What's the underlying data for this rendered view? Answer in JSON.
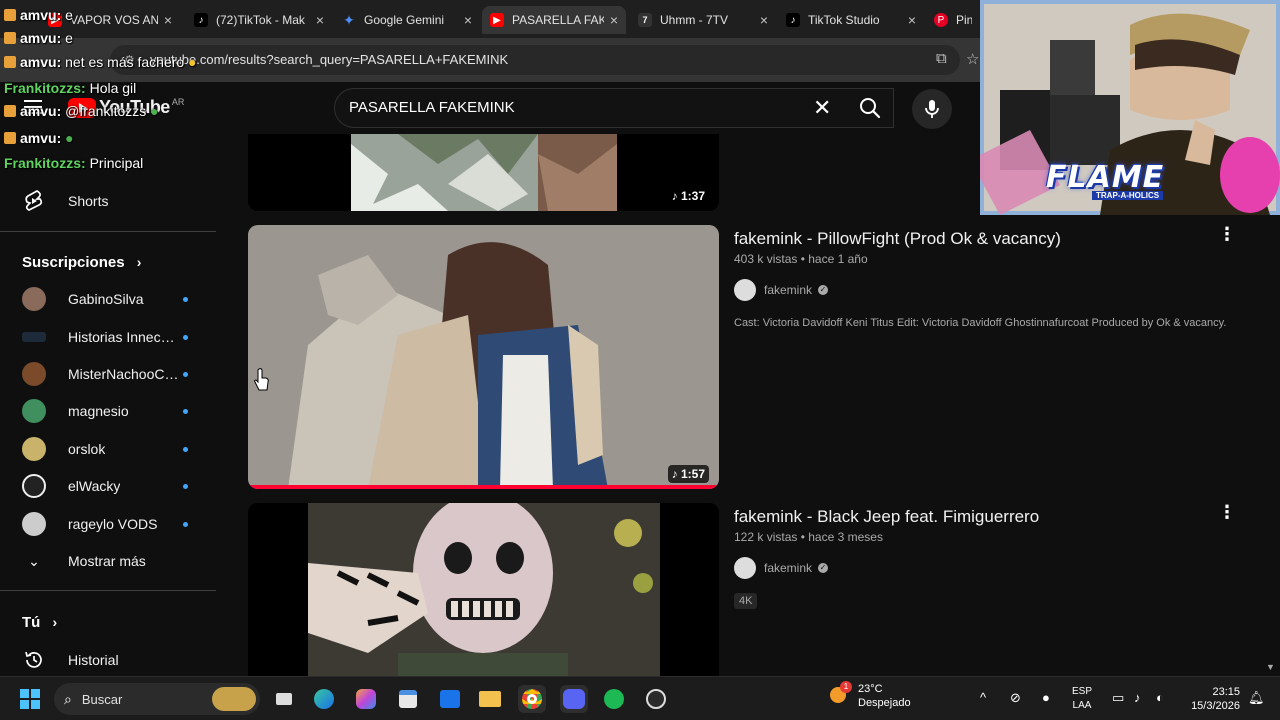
{
  "browser": {
    "tabs": [
      {
        "label": "VAPOR VOS AN",
        "favicon": "youtube-icon",
        "color": "#ff0000",
        "active": false
      },
      {
        "label": "(72)TikTok - Mak",
        "favicon": "tiktok-icon",
        "color": "#000000",
        "active": false
      },
      {
        "label": "Google Gemini",
        "favicon": "gemini-icon",
        "color": "#4f8ef7",
        "active": false
      },
      {
        "label": "PASARELLA FAK",
        "favicon": "youtube-icon",
        "color": "#ff0000",
        "active": true
      },
      {
        "label": "Uhmm - 7TV",
        "favicon": "7tv-icon",
        "color": "#333333",
        "active": false
      },
      {
        "label": "TikTok Studio",
        "favicon": "tiktok-icon",
        "color": "#000000",
        "active": false
      },
      {
        "label": "Pinte",
        "favicon": "pinterest-icon",
        "color": "#e60023",
        "active": false
      }
    ],
    "url": "youtube.com/results?search_query=PASARELLA+FAKEMINK"
  },
  "youtube": {
    "logo_word": "YouTube",
    "country": "AR",
    "search_query": "PASARELLA FAKEMINK"
  },
  "sidebar": {
    "shorts": "Shorts",
    "subscriptions_header": "Suscripciones",
    "subscriptions": [
      {
        "label": "GabinoSilva",
        "color": "#8a6a5a"
      },
      {
        "label": "Historias Innece...",
        "color": "#1d2a3a"
      },
      {
        "label": "MisterNachooCli...",
        "color": "#7a4a2a"
      },
      {
        "label": "magnesio",
        "color": "#3f8f5f"
      },
      {
        "label": "orslok",
        "color": "#c9b36a"
      },
      {
        "label": "elWacky",
        "color": "#222222"
      },
      {
        "label": "rageylo VODS",
        "color": "#cccccc"
      }
    ],
    "show_more": "Mostrar más",
    "you_header": "Tú",
    "history": "Historial"
  },
  "results": [
    {
      "duration": "1:37"
    },
    {
      "title": "fakemink - PillowFight (Prod Ok & vacancy)",
      "meta": "403 k vistas • hace 1 año",
      "channel": "fakemink",
      "description": "Cast: Victoria Davidoff Keni Titus Edit: Victoria Davidoff Ghostinnafurcoat Produced by Ok & vacancy.",
      "duration": "1:57",
      "watched_fraction": 1.0
    },
    {
      "title": "fakemink - Black Jeep feat. Fimiguerrero",
      "meta": "122 k vistas • hace 3 meses",
      "channel": "fakemink",
      "badge": "4K"
    }
  ],
  "chat": [
    {
      "user": "amvu:",
      "text": "e",
      "color": "#ffffff"
    },
    {
      "user": "amvu:",
      "text": "e",
      "color": "#ffffff"
    },
    {
      "user": "amvu:",
      "text": "net es más fachero",
      "color": "#ffffff"
    },
    {
      "user": "Frankitozzs:",
      "text": "Hola gil",
      "color": "#5fd35f"
    },
    {
      "user": "amvu:",
      "text": "@frankitozzs",
      "color": "#ffffff"
    },
    {
      "user": "amvu:",
      "text": "",
      "color": "#ffffff"
    },
    {
      "user": "Frankitozzs:",
      "text": "Principal",
      "color": "#5fd35f"
    }
  ],
  "overlay": {
    "flame_title": "FLAME",
    "flame_subtitle": "TRAP-A-HOLICS"
  },
  "taskbar": {
    "search_label": "Buscar",
    "weather_temp": "23°C",
    "weather_desc": "Despejado",
    "weather_badge": "1",
    "lang_top": "ESP",
    "lang_bottom": "LAA",
    "time": "23:15",
    "date": "15/3/2026"
  }
}
